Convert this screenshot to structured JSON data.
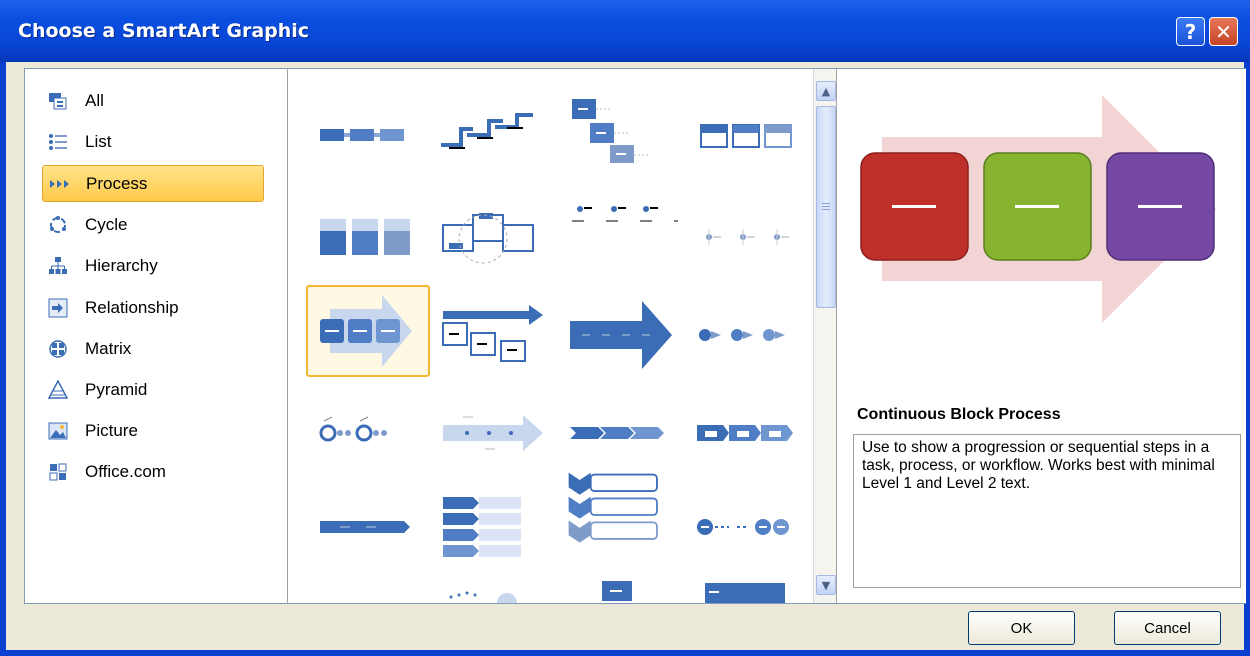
{
  "window": {
    "title": "Choose a SmartArt Graphic",
    "help_label": "?",
    "close_label": "✕"
  },
  "categories": [
    {
      "label": "All",
      "icon": "all-icon"
    },
    {
      "label": "List",
      "icon": "list-icon"
    },
    {
      "label": "Process",
      "icon": "process-icon"
    },
    {
      "label": "Cycle",
      "icon": "cycle-icon"
    },
    {
      "label": "Hierarchy",
      "icon": "hierarchy-icon"
    },
    {
      "label": "Relationship",
      "icon": "relationship-icon"
    },
    {
      "label": "Matrix",
      "icon": "matrix-icon"
    },
    {
      "label": "Pyramid",
      "icon": "pyramid-icon"
    },
    {
      "label": "Picture",
      "icon": "picture-icon"
    },
    {
      "label": "Office.com",
      "icon": "office-com-icon"
    }
  ],
  "selected_category": "Process",
  "preview": {
    "name": "Continuous Block Process",
    "description": "Use to show a progression or sequential steps in a task, process, or workflow. Works best with minimal Level 1 and Level 2 text.",
    "block_colors": [
      "#c0302b",
      "#86b430",
      "#7548a4"
    ],
    "arrow_color": "#f2d4d4"
  },
  "buttons": {
    "ok": "OK",
    "cancel": "Cancel"
  },
  "colors": {
    "titlebar": "#0a4fe0",
    "selection": "#ffd466",
    "thumb_blue": "#3b6cb6"
  }
}
